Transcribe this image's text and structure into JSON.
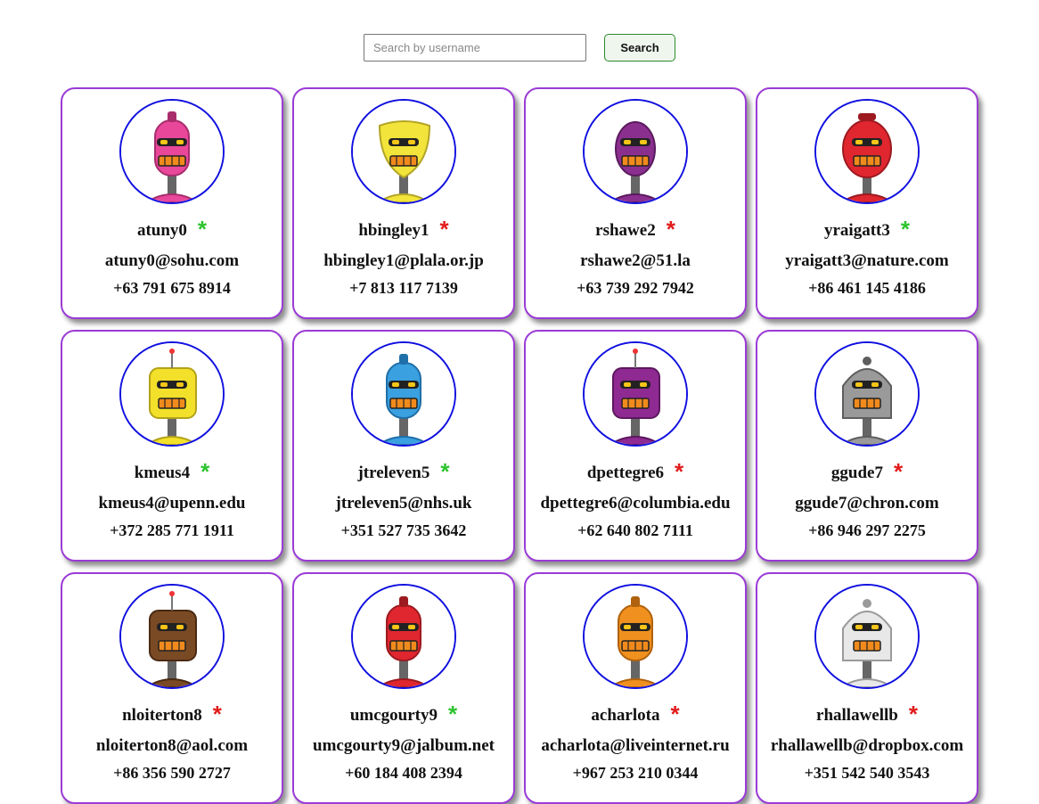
{
  "search": {
    "placeholder": "Search by username",
    "button_label": "Search"
  },
  "users": [
    {
      "username": "atuny0",
      "email": "atuny0@sohu.com",
      "phone": "+63 791 675 8914",
      "status_icon": "*",
      "status": "online",
      "robot": {
        "color": "#e8479a",
        "dark": "#a82d6d",
        "shape": "tall"
      }
    },
    {
      "username": "hbingley1",
      "email": "hbingley1@plala.or.jp",
      "phone": "+7 813 117 7139",
      "status_icon": "*",
      "status": "offline",
      "robot": {
        "color": "#f2e43a",
        "dark": "#b3a526",
        "shape": "shield"
      }
    },
    {
      "username": "rshawe2",
      "email": "rshawe2@51.la",
      "phone": "+63 739 292 7942",
      "status_icon": "*",
      "status": "offline",
      "robot": {
        "color": "#8b2f8f",
        "dark": "#5a1a5e",
        "shape": "egg"
      }
    },
    {
      "username": "yraigatt3",
      "email": "yraigatt3@nature.com",
      "phone": "+86 461 145 4186",
      "status_icon": "*",
      "status": "online",
      "robot": {
        "color": "#e0262f",
        "dark": "#9c1a20",
        "shape": "round"
      }
    },
    {
      "username": "kmeus4",
      "email": "kmeus4@upenn.edu",
      "phone": "+372 285 771 1911",
      "status_icon": "*",
      "status": "online",
      "robot": {
        "color": "#f2e02a",
        "dark": "#b3a21a",
        "shape": "box"
      }
    },
    {
      "username": "jtreleven5",
      "email": "jtreleven5@nhs.uk",
      "phone": "+351 527 735 3642",
      "status_icon": "*",
      "status": "online",
      "robot": {
        "color": "#3aa0e0",
        "dark": "#1f6fa8",
        "shape": "tall"
      }
    },
    {
      "username": "dpettegre6",
      "email": "dpettegre6@columbia.edu",
      "phone": "+62 640 802 7111",
      "status_icon": "*",
      "status": "offline",
      "robot": {
        "color": "#8f2a92",
        "dark": "#5c175e",
        "shape": "box"
      }
    },
    {
      "username": "ggude7",
      "email": "ggude7@chron.com",
      "phone": "+86 946 297 2275",
      "status_icon": "*",
      "status": "offline",
      "robot": {
        "color": "#9a9a9a",
        "dark": "#5e5e5e",
        "shape": "dome"
      }
    },
    {
      "username": "nloiterton8",
      "email": "nloiterton8@aol.com",
      "phone": "+86 356 590 2727",
      "status_icon": "*",
      "status": "offline",
      "robot": {
        "color": "#7a4a25",
        "dark": "#4a2a12",
        "shape": "box"
      }
    },
    {
      "username": "umcgourty9",
      "email": "umcgourty9@jalbum.net",
      "phone": "+60 184 408 2394",
      "status_icon": "*",
      "status": "online",
      "robot": {
        "color": "#e0262f",
        "dark": "#9c1a20",
        "shape": "tall"
      }
    },
    {
      "username": "acharlota",
      "email": "acharlota@liveinternet.ru",
      "phone": "+967 253 210 0344",
      "status_icon": "*",
      "status": "offline",
      "robot": {
        "color": "#f0901e",
        "dark": "#b0620e",
        "shape": "tall"
      }
    },
    {
      "username": "rhallawellb",
      "email": "rhallawellb@dropbox.com",
      "phone": "+351 542 540 3543",
      "status_icon": "*",
      "status": "offline",
      "robot": {
        "color": "#e8e8e8",
        "dark": "#9a9a9a",
        "shape": "dome"
      }
    }
  ]
}
